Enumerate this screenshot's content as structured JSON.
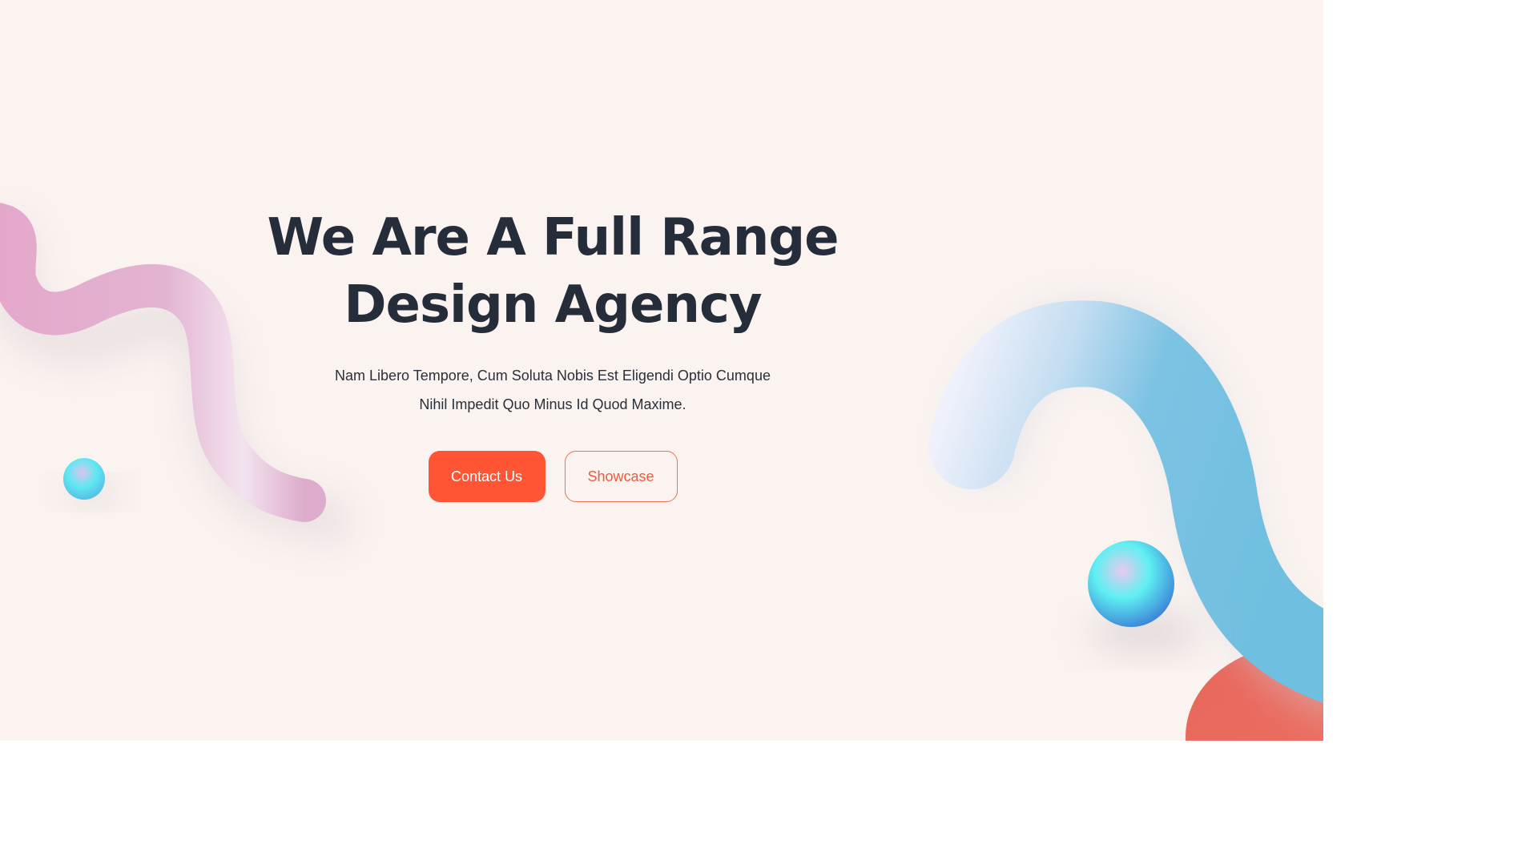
{
  "hero": {
    "title_line1": "We Are A Full Range",
    "title_line2": "Design Agency",
    "subtitle_line1": "Nam Libero Tempore, Cum Soluta Nobis Est Eligendi Optio Cumque",
    "subtitle_line2": "Nihil Impedit Quo Minus Id Quod Maxime.",
    "primary_button": "Contact Us",
    "secondary_button": "Showcase"
  },
  "colors": {
    "background": "#faf3f0",
    "heading": "#262d3a",
    "accent": "#ff5534",
    "pink_shape": "#e2aed0",
    "blue_shape": "#74bfe0",
    "sphere": "#5fe3ef",
    "coral_blob": "#ec6b5e"
  },
  "decorations": [
    "pink-squiggle-shape",
    "small-cyan-sphere",
    "blue-arch-shape",
    "large-cyan-sphere",
    "coral-blob-shape"
  ]
}
